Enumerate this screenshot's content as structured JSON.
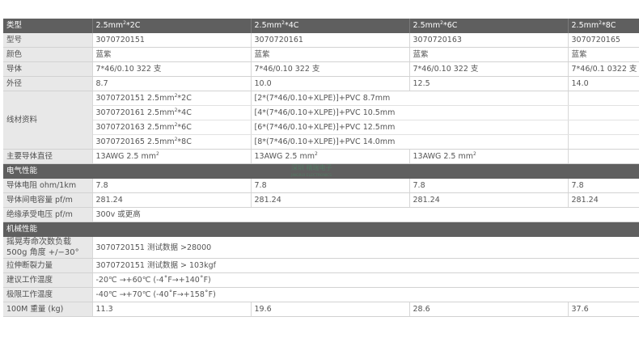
{
  "header": {
    "type_label": "类型",
    "types": [
      {
        "base": "2.5mm",
        "sup": "2",
        "tail": "*2C"
      },
      {
        "base": "2.5mm",
        "sup": "2",
        "tail": "*4C"
      },
      {
        "base": "2.5mm",
        "sup": "2",
        "tail": "*6C"
      },
      {
        "base": "2.5mm",
        "sup": "2",
        "tail": "*8C"
      }
    ]
  },
  "rows": {
    "model": {
      "label": "型号",
      "values": [
        "3070720151",
        "3070720161",
        "3070720163",
        "3070720165"
      ]
    },
    "color": {
      "label": "颜色",
      "values": [
        "蓝紫",
        "蓝紫",
        "蓝紫",
        "蓝紫"
      ]
    },
    "conductor": {
      "label": "导体",
      "values": [
        "7*46/0.10  322 支",
        "7*46/0.10  322 支",
        "7*46/0.10  322 支",
        "7*46/0.1  0322 支"
      ]
    },
    "od": {
      "label": "外径",
      "values": [
        "8.7",
        "10.0",
        "12.5",
        "14.0"
      ]
    }
  },
  "cable_info": {
    "label": "线材资料",
    "items": [
      {
        "model": "3070720151  2.5mm",
        "sup": "2",
        "tail": "*2C",
        "spec": "[2*(7*46/0.10+XLPE)]+PVC 8.7mm"
      },
      {
        "model": "3070720161  2.5mm",
        "sup": "2",
        "tail": "*4C",
        "spec": "[4*(7*46/0.10+XLPE)]+PVC 10.5mm"
      },
      {
        "model": "3070720163  2.5mm",
        "sup": "2",
        "tail": "*6C",
        "spec": "[6*(7*46/0.10+XLPE)]+PVC 12.5mm"
      },
      {
        "model": "3070720165  2.5mm",
        "sup": "2",
        "tail": "*8C",
        "spec": "[8*(7*46/0.10+XLPE)]+PVC 14.0mm"
      }
    ]
  },
  "main_diameter": {
    "label": "主要导体直径",
    "values": [
      {
        "base": "13AWG 2.5 mm",
        "sup": "2"
      },
      {
        "base": "13AWG 2.5 mm",
        "sup": "2"
      },
      {
        "base": "13AWG 2.5 mm",
        "sup": "2"
      }
    ]
  },
  "electrical": {
    "section": "电气性能",
    "resistance": {
      "label": "导体电阻 ohm/1km",
      "values": [
        "7.8",
        "7.8",
        "7.8",
        "7.8"
      ]
    },
    "capacitance": {
      "label": "导体间电容量 pf/m",
      "values": [
        "281.24",
        "281.24",
        "281.24",
        "281.24"
      ]
    },
    "voltage": {
      "label": "绝缘承受电压 pf/m",
      "value": "300v 或更高"
    }
  },
  "mechanical": {
    "section": "机械性能",
    "swing": {
      "label_line1": "摇晃寿命次数负载",
      "label_line2": "500g 角度 +/−30°",
      "value": "3070720151 测试数据 >28000"
    },
    "tensile": {
      "label": "拉伸断裂力量",
      "value": "3070720151 测试数据 > 103kgf"
    },
    "rec_temp": {
      "label": "建议工作温度",
      "value": "-20℃ →+60℃ (-4˚F→+140˚F)"
    },
    "limit_temp": {
      "label": "极限工作温度",
      "value": "-40℃ →+70℃ (-40˚F→+158˚F)"
    },
    "weight": {
      "label": "100M 重量 (kg)",
      "values": [
        "11.3",
        "19.6",
        "28.6",
        "37.6"
      ]
    }
  },
  "watermark": {
    "line1": "深圳 精瑞电子",
    "line2": "JINGRUI ELECTRONICS"
  },
  "colors": {
    "header_bg": "#5f5f5f",
    "label_bg": "#e8e8e8",
    "border": "#d2d2d2"
  }
}
